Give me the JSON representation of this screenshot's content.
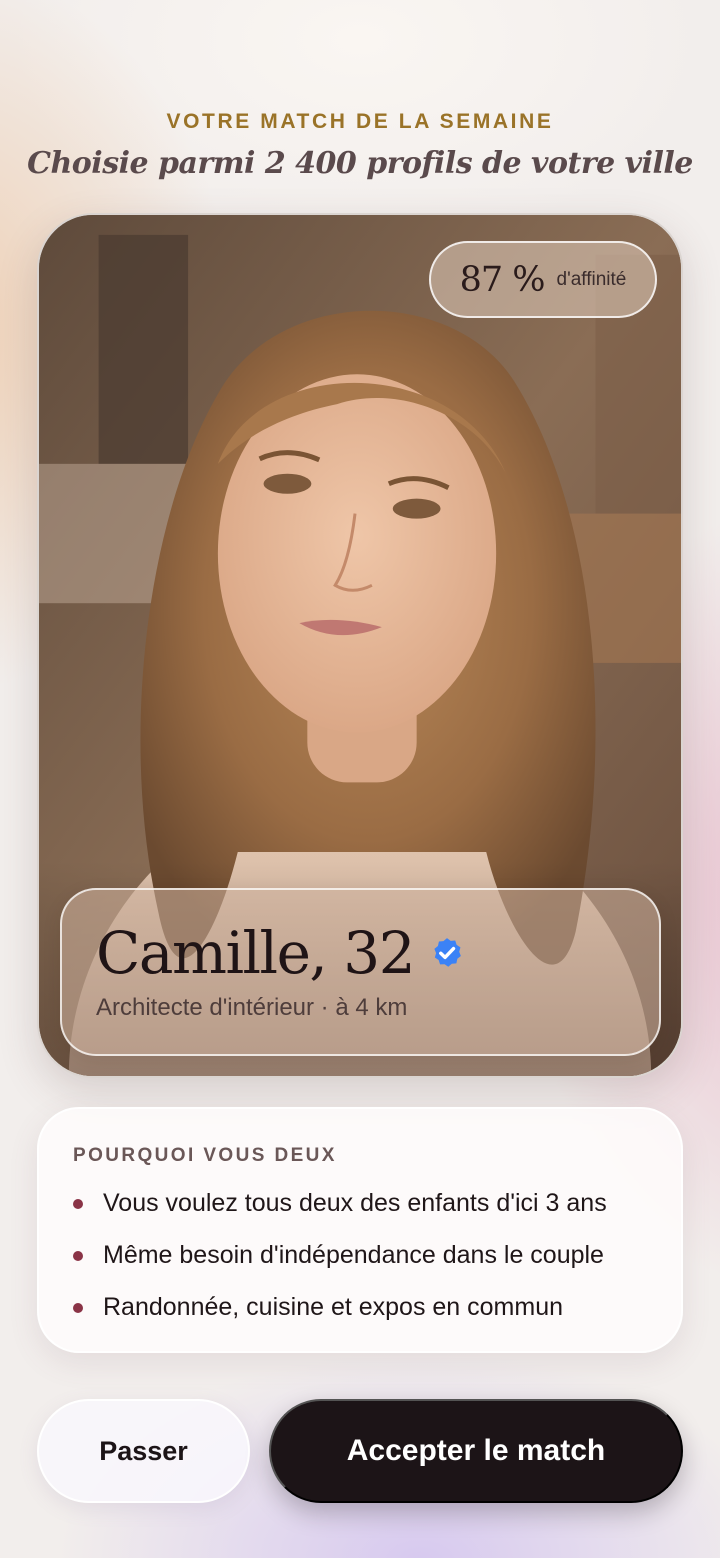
{
  "header": {
    "eyebrow": "VOTRE MATCH DE LA SEMAINE",
    "subtitle": "Choisie parmi 2 400 profils de votre ville"
  },
  "profile": {
    "affinity_value": "87 %",
    "affinity_label": "d'affinité",
    "name": "Camille, 32",
    "verified_icon": "verified-check-icon",
    "details": "Architecte d'intérieur · à 4 km"
  },
  "reasons": {
    "title": "POURQUOI VOUS DEUX",
    "items": [
      "Vous voulez tous deux des enfants d'ici 3 ans",
      "Même besoin d'indépendance dans le couple",
      "Randonnée, cuisine et expos en commun"
    ]
  },
  "actions": {
    "skip_label": "Passer",
    "accept_label": "Accepter le match"
  },
  "colors": {
    "accent_gold": "#9a7328",
    "bullet": "#8a3346",
    "primary_button": "#1c1417",
    "verified_blue": "#3b82f6"
  }
}
